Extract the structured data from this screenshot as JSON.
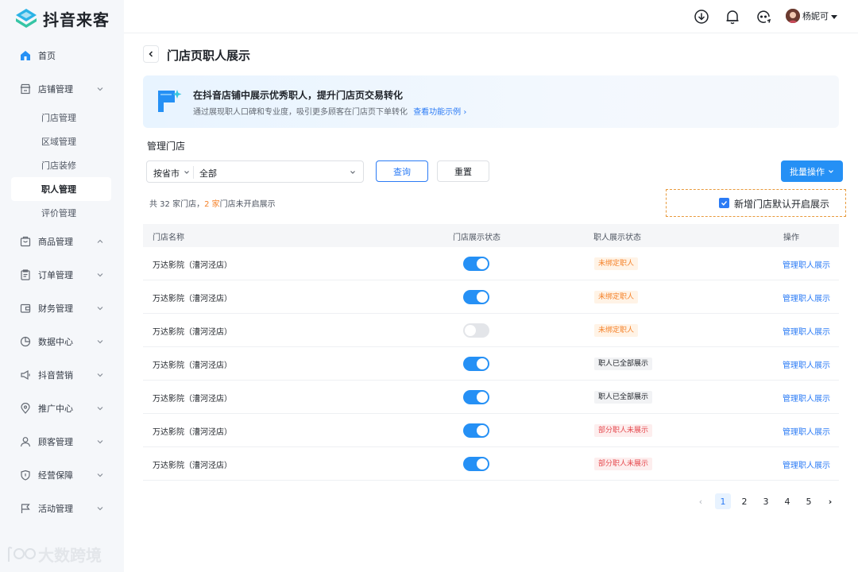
{
  "app": {
    "name": "抖音来客"
  },
  "sidebar": {
    "items": [
      {
        "label": "首页",
        "icon": "home-icon"
      },
      {
        "label": "店铺管理",
        "icon": "store-icon",
        "expanded": true
      },
      {
        "label": "商品管理",
        "icon": "product-icon",
        "expanded": true
      },
      {
        "label": "订单管理",
        "icon": "order-icon"
      },
      {
        "label": "财务管理",
        "icon": "wallet-icon"
      },
      {
        "label": "数据中心",
        "icon": "chart-icon"
      },
      {
        "label": "抖音营销",
        "icon": "marketing-icon"
      },
      {
        "label": "推广中心",
        "icon": "location-icon"
      },
      {
        "label": "顾客管理",
        "icon": "user-icon"
      },
      {
        "label": "经营保障",
        "icon": "shield-icon"
      },
      {
        "label": "活动管理",
        "icon": "flag-icon"
      }
    ],
    "sub_items": [
      "门店管理",
      "区域管理",
      "门店装修",
      "职人管理",
      "评价管理"
    ],
    "active_sub": "职人管理"
  },
  "watermark": "大数跨境",
  "header": {
    "username": "杨妮可"
  },
  "page": {
    "title": "门店页职人展示",
    "banner": {
      "title": "在抖音店铺中展示优秀职人，提升门店页交易转化",
      "desc": "通过展现职人口碑和专业度，吸引更多顾客在门店页下单转化",
      "link": "查看功能示例 ›"
    },
    "section_title": "管理门店",
    "filter": {
      "region_label": "按省市",
      "region_value": "全部"
    },
    "buttons": {
      "query": "查询",
      "reset": "重置",
      "batch": "批量操作"
    },
    "summary": {
      "prefix": "共 32 家门店，",
      "count": "2 家",
      "suffix": "门店未开启展示"
    },
    "default_show": {
      "label": "新增门店默认开启展示",
      "checked": true
    }
  },
  "table": {
    "columns": [
      "门店名称",
      "门店展示状态",
      "职人展示状态",
      "操作"
    ],
    "rows": [
      {
        "name": "万达影院（漕河泾店）",
        "enabled": true,
        "status": "未绑定职人",
        "status_type": "warn",
        "action": "管理职人展示"
      },
      {
        "name": "万达影院（漕河泾店）",
        "enabled": true,
        "status": "未绑定职人",
        "status_type": "warn",
        "action": "管理职人展示"
      },
      {
        "name": "万达影院（漕河泾店）",
        "enabled": false,
        "status": "未绑定职人",
        "status_type": "warn",
        "action": "管理职人展示"
      },
      {
        "name": "万达影院（漕河泾店）",
        "enabled": true,
        "status": "职人已全部展示",
        "status_type": "ok",
        "action": "管理职人展示"
      },
      {
        "name": "万达影院（漕河泾店）",
        "enabled": true,
        "status": "职人已全部展示",
        "status_type": "ok",
        "action": "管理职人展示"
      },
      {
        "name": "万达影院（漕河泾店）",
        "enabled": true,
        "status": "部分职人未展示",
        "status_type": "err",
        "action": "管理职人展示"
      },
      {
        "name": "万达影院（漕河泾店）",
        "enabled": true,
        "status": "部分职人未展示",
        "status_type": "err",
        "action": "管理职人展示"
      }
    ]
  },
  "pagination": {
    "pages": [
      "1",
      "2",
      "3",
      "4",
      "5"
    ],
    "current": "1",
    "prev": "‹",
    "next": "›"
  },
  "colors": {
    "primary": "#2590f5",
    "link": "#2b7bf5",
    "warning": "#f5822a",
    "error": "#e5484d"
  }
}
